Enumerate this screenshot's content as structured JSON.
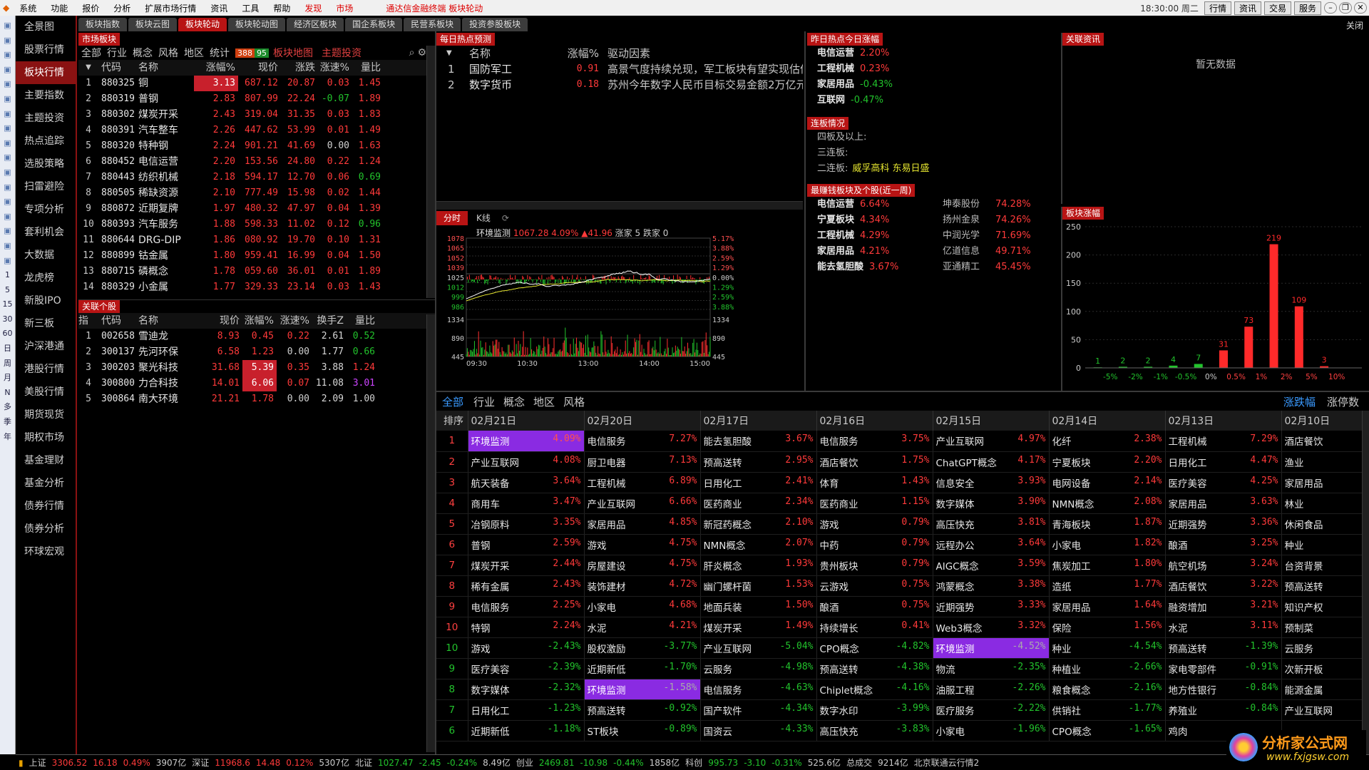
{
  "menubar": {
    "items": [
      "系统",
      "功能",
      "报价",
      "分析",
      "扩展市场行情",
      "资讯",
      "工具",
      "发现",
      "市场"
    ],
    "promo": "通达信金融终端  板块轮动",
    "clock": "18:30:00 周二",
    "right_buttons": [
      "行情",
      "资讯",
      "交易",
      "服务"
    ]
  },
  "iconstrip": [
    "",
    "",
    "",
    "",
    "",
    "",
    "",
    "",
    "",
    "",
    "",
    "",
    "",
    "",
    "",
    "",
    "",
    "1",
    "5",
    "15",
    "30",
    "60",
    "日",
    "周",
    "月",
    "N",
    "多",
    "季",
    "年"
  ],
  "leftnav": [
    "全景图",
    "股票行情",
    "板块行情",
    "主要指数",
    "主题投资",
    "热点追踪",
    "选股策略",
    "扫雷避险",
    "专项分析",
    "套利机会",
    "大数据",
    "龙虎榜",
    "新股IPO",
    "新三板",
    "沪深港通",
    "港股行情",
    "美股行情",
    "期货现货",
    "期权市场",
    "基金理财",
    "基金分析",
    "债券行情",
    "债券分析",
    "环球宏观"
  ],
  "tabs": [
    "板块指数",
    "板块云图",
    "板块轮动",
    "板块轮动图",
    "经济区板块",
    "国企系板块",
    "民营系板块",
    "投资参股板块"
  ],
  "tabs_close": "关闭",
  "market": {
    "title": "市场板块",
    "filters": [
      "全部",
      "行业",
      "概念",
      "风格",
      "地区",
      "统计"
    ],
    "badge_up": "388",
    "badge_dn": "95",
    "links": [
      "板块地图",
      "主题投资"
    ],
    "headers": [
      "",
      "代码",
      "名称",
      "涨幅%",
      "现价",
      "涨跌",
      "涨速%",
      "量比"
    ],
    "rows": [
      [
        "1",
        "880325",
        "铜",
        "3.13",
        "687.12",
        "20.87",
        "0.03",
        "1.45"
      ],
      [
        "2",
        "880319",
        "普钢",
        "2.83",
        "807.99",
        "22.24",
        "-0.07",
        "1.89"
      ],
      [
        "3",
        "880302",
        "煤炭开采",
        "2.43",
        "319.04",
        "31.35",
        "0.03",
        "1.83"
      ],
      [
        "4",
        "880391",
        "汽车整车",
        "2.26",
        "447.62",
        "53.99",
        "0.01",
        "1.49"
      ],
      [
        "5",
        "880320",
        "特种钢",
        "2.24",
        "901.21",
        "41.69",
        "0.00",
        "1.63"
      ],
      [
        "6",
        "880452",
        "电信运营",
        "2.20",
        "153.56",
        "24.80",
        "0.22",
        "1.24"
      ],
      [
        "7",
        "880443",
        "纺织机械",
        "2.18",
        "594.17",
        "12.70",
        "0.06",
        "0.69"
      ],
      [
        "8",
        "880505",
        "稀缺资源",
        "2.10",
        "777.49",
        "15.98",
        "0.02",
        "1.44"
      ],
      [
        "9",
        "880872",
        "近期复牌",
        "1.97",
        "480.32",
        "47.97",
        "0.04",
        "1.39"
      ],
      [
        "10",
        "880393",
        "汽车服务",
        "1.88",
        "598.33",
        "11.02",
        "0.12",
        "0.96"
      ],
      [
        "11",
        "880644",
        "DRG-DIP",
        "1.86",
        "080.92",
        "19.70",
        "0.10",
        "1.31"
      ],
      [
        "12",
        "880899",
        "钴金属",
        "1.80",
        "959.41",
        "16.99",
        "0.04",
        "1.50"
      ],
      [
        "13",
        "880715",
        "磷概念",
        "1.78",
        "059.60",
        "36.01",
        "0.01",
        "1.89"
      ],
      [
        "14",
        "880329",
        "小金属",
        "1.77",
        "329.33",
        "23.14",
        "0.03",
        "1.43"
      ]
    ]
  },
  "related": {
    "title": "关联个股",
    "headers": [
      "指",
      "代码",
      "名称",
      "现价",
      "涨幅%",
      "涨速%",
      "换手Z",
      "量比"
    ],
    "rows": [
      [
        "1",
        "002658",
        "雪迪龙",
        "8.93",
        "0.45",
        "0.22",
        "2.61",
        "0.52"
      ],
      [
        "2",
        "300137",
        "先河环保",
        "6.58",
        "1.23",
        "0.00",
        "1.77",
        "0.66"
      ],
      [
        "3",
        "300203",
        "聚光科技",
        "31.68",
        "5.39",
        "0.35",
        "3.88",
        "1.24"
      ],
      [
        "4",
        "300800",
        "力合科技",
        "14.01",
        "6.06",
        "0.07",
        "11.08",
        "3.01"
      ],
      [
        "5",
        "300864",
        "南大环境",
        "21.21",
        "1.78",
        "0.00",
        "2.09",
        "1.00"
      ]
    ]
  },
  "hotspot": {
    "title": "每日热点预测",
    "headers": [
      "名称",
      "涨幅%",
      "驱动因素"
    ],
    "rows": [
      [
        "1",
        "国防军工",
        "0.91",
        "高景气度持续兑现，军工板块有望实现估值"
      ],
      [
        "2",
        "数字货币",
        "0.18",
        "苏州今年数字人民币目标交易金额2万亿元"
      ]
    ]
  },
  "yesterday": {
    "title": "昨日热点今日涨幅",
    "rows": [
      [
        "电信运营",
        "2.20%"
      ],
      [
        "工程机械",
        "0.23%"
      ],
      [
        "家居用品",
        "-0.43%"
      ],
      [
        "互联网",
        "-0.47%"
      ]
    ]
  },
  "lianban": {
    "title": "连板情况",
    "rows": [
      [
        "四板及以上:",
        ""
      ],
      [
        "三连板:",
        ""
      ],
      [
        "二连板:",
        "威孚高科  东易日盛"
      ]
    ]
  },
  "weekly": {
    "title": "最赚钱板块及个股(近一周)",
    "sectors": [
      [
        "电信运营",
        "6.64%"
      ],
      [
        "宁夏板块",
        "4.34%"
      ],
      [
        "工程机械",
        "4.29%"
      ],
      [
        "家居用品",
        "4.21%"
      ],
      [
        "能去氢胆酸",
        "3.67%"
      ]
    ],
    "stocks": [
      [
        "坤泰股份",
        "74.28%"
      ],
      [
        "扬州金泉",
        "74.26%"
      ],
      [
        "中润光学",
        "71.69%"
      ],
      [
        "亿道信息",
        "49.71%"
      ],
      [
        "亚通精工",
        "45.45%"
      ]
    ]
  },
  "news": {
    "title": "关联资讯",
    "empty": "暂无数据"
  },
  "chart_tabs": [
    "分时",
    "K线"
  ],
  "intraday": {
    "title": "环境监测",
    "price": "1067.28",
    "pct": "4.09%",
    "chg": "▲41.96",
    "up_label": "涨家 5",
    "dn_label": "跌家 0",
    "left_ticks": [
      "1078",
      "1065",
      "1052",
      "1039",
      "1025",
      "1012",
      "999",
      "986",
      "1334",
      "890",
      "445"
    ],
    "right_ticks": [
      "5.17%",
      "3.88%",
      "2.59%",
      "1.29%",
      "0.00%",
      "1.29%",
      "2.59%",
      "3.88%",
      "1334",
      "890",
      "445"
    ],
    "time_ticks": [
      "09:30",
      "10:30",
      "13:00",
      "14:00",
      "15:00"
    ]
  },
  "dist": {
    "title": "板块涨幅",
    "y_ticks": [
      "250",
      "200",
      "150",
      "100",
      "50",
      "0"
    ],
    "x_ticks": [
      "-5%",
      "-2%",
      "-1%",
      "-0.5%",
      "0%",
      "0.5%",
      "1%",
      "2%",
      "5%",
      "10%"
    ]
  },
  "chart_data": {
    "type": "bar",
    "title": "板块涨幅",
    "categories": [
      "<-5%",
      "-5%~-2%",
      "-2%~-1%",
      "-1%~-0.5%",
      "-0.5%~0%",
      "0%~0.5%",
      "0.5%~1%",
      "1%~2%",
      "2%~5%",
      "5%~10%",
      ">10%"
    ],
    "values": [
      1,
      2,
      2,
      4,
      7,
      31,
      73,
      219,
      109,
      3,
      0
    ],
    "ylim": [
      0,
      250
    ],
    "colors": {
      "down": "#22c32c",
      "up": "#ff2a2a"
    }
  },
  "rank": {
    "filters": [
      "全部",
      "行业",
      "概念",
      "地区",
      "风格"
    ],
    "right_tabs": [
      "涨跌幅",
      "涨停数"
    ],
    "headers": [
      "排序",
      "02月21日",
      "02月20日",
      "02月17日",
      "02月16日",
      "02月15日",
      "02月14日",
      "02月13日",
      "02月10日"
    ],
    "rows": [
      [
        "1",
        [
          "环境监测",
          "4.09%"
        ],
        [
          "电信服务",
          "7.27%"
        ],
        [
          "能去氢胆酸",
          "3.67%"
        ],
        [
          "电信服务",
          "3.75%"
        ],
        [
          "产业互联网",
          "4.97%"
        ],
        [
          "化纤",
          "2.38%"
        ],
        [
          "工程机械",
          "7.29%"
        ],
        [
          "酒店餐饮",
          ""
        ]
      ],
      [
        "2",
        [
          "产业互联网",
          "4.08%"
        ],
        [
          "厨卫电器",
          "7.13%"
        ],
        [
          "预高送转",
          "2.95%"
        ],
        [
          "酒店餐饮",
          "1.75%"
        ],
        [
          "ChatGPT概念",
          "4.17%"
        ],
        [
          "宁夏板块",
          "2.20%"
        ],
        [
          "日用化工",
          "4.47%"
        ],
        [
          "渔业",
          ""
        ]
      ],
      [
        "3",
        [
          "航天装备",
          "3.64%"
        ],
        [
          "工程机械",
          "6.89%"
        ],
        [
          "日用化工",
          "2.41%"
        ],
        [
          "体育",
          "1.43%"
        ],
        [
          "信息安全",
          "3.93%"
        ],
        [
          "电网设备",
          "2.14%"
        ],
        [
          "医疗美容",
          "4.25%"
        ],
        [
          "家居用品",
          ""
        ]
      ],
      [
        "4",
        [
          "商用车",
          "3.47%"
        ],
        [
          "产业互联网",
          "6.66%"
        ],
        [
          "医药商业",
          "2.34%"
        ],
        [
          "医药商业",
          "1.15%"
        ],
        [
          "数字媒体",
          "3.90%"
        ],
        [
          "NMN概念",
          "2.08%"
        ],
        [
          "家居用品",
          "3.63%"
        ],
        [
          "林业",
          ""
        ]
      ],
      [
        "5",
        [
          "冶钢原料",
          "3.35%"
        ],
        [
          "家居用品",
          "4.85%"
        ],
        [
          "新冠药概念",
          "2.10%"
        ],
        [
          "游戏",
          "0.79%"
        ],
        [
          "高压快充",
          "3.81%"
        ],
        [
          "青海板块",
          "1.87%"
        ],
        [
          "近期强势",
          "3.36%"
        ],
        [
          "休闲食品",
          ""
        ]
      ],
      [
        "6",
        [
          "普钢",
          "2.59%"
        ],
        [
          "游戏",
          "4.75%"
        ],
        [
          "NMN概念",
          "2.07%"
        ],
        [
          "中药",
          "0.79%"
        ],
        [
          "远程办公",
          "3.64%"
        ],
        [
          "小家电",
          "1.82%"
        ],
        [
          "酿酒",
          "3.25%"
        ],
        [
          "种业",
          ""
        ]
      ],
      [
        "7",
        [
          "煤炭开采",
          "2.44%"
        ],
        [
          "房屋建设",
          "4.75%"
        ],
        [
          "肝炎概念",
          "1.93%"
        ],
        [
          "贵州板块",
          "0.79%"
        ],
        [
          "AIGC概念",
          "3.59%"
        ],
        [
          "焦炭加工",
          "1.80%"
        ],
        [
          "航空机场",
          "3.24%"
        ],
        [
          "台资背景",
          ""
        ]
      ],
      [
        "8",
        [
          "稀有金属",
          "2.43%"
        ],
        [
          "装饰建材",
          "4.72%"
        ],
        [
          "幽门螺杆菌",
          "1.53%"
        ],
        [
          "云游戏",
          "0.75%"
        ],
        [
          "鸿蒙概念",
          "3.38%"
        ],
        [
          "造纸",
          "1.77%"
        ],
        [
          "酒店餐饮",
          "3.22%"
        ],
        [
          "预高送转",
          ""
        ]
      ],
      [
        "9",
        [
          "电信服务",
          "2.25%"
        ],
        [
          "小家电",
          "4.68%"
        ],
        [
          "地面兵装",
          "1.50%"
        ],
        [
          "酿酒",
          "0.75%"
        ],
        [
          "近期强势",
          "3.33%"
        ],
        [
          "家居用品",
          "1.64%"
        ],
        [
          "融资增加",
          "3.21%"
        ],
        [
          "知识产权",
          ""
        ]
      ],
      [
        "10",
        [
          "特钢",
          "2.24%"
        ],
        [
          "水泥",
          "4.21%"
        ],
        [
          "煤炭开采",
          "1.49%"
        ],
        [
          "持续增长",
          "0.41%"
        ],
        [
          "Web3概念",
          "3.32%"
        ],
        [
          "保险",
          "1.56%"
        ],
        [
          "水泥",
          "3.11%"
        ],
        [
          "预制菜",
          ""
        ]
      ],
      [
        "10",
        [
          "游戏",
          "-2.43%"
        ],
        [
          "股权激励",
          "-3.77%"
        ],
        [
          "产业互联网",
          "-5.04%"
        ],
        [
          "CPO概念",
          "-4.82%"
        ],
        [
          "环境监测",
          "-4.52%"
        ],
        [
          "种业",
          "-4.54%"
        ],
        [
          "预高送转",
          "-1.39%"
        ],
        [
          "云服务",
          ""
        ]
      ],
      [
        "9",
        [
          "医疗美容",
          "-2.39%"
        ],
        [
          "近期新低",
          "-1.70%"
        ],
        [
          "云服务",
          "-4.98%"
        ],
        [
          "预高送转",
          "-4.38%"
        ],
        [
          "物流",
          "-2.35%"
        ],
        [
          "种植业",
          "-2.66%"
        ],
        [
          "家电零部件",
          "-0.91%"
        ],
        [
          "次新开板",
          ""
        ]
      ],
      [
        "8",
        [
          "数字媒体",
          "-2.32%"
        ],
        [
          "环境监测",
          "-1.58%"
        ],
        [
          "电信服务",
          "-4.63%"
        ],
        [
          "Chiplet概念",
          "-4.16%"
        ],
        [
          "油服工程",
          "-2.26%"
        ],
        [
          "粮食概念",
          "-2.16%"
        ],
        [
          "地方性银行",
          "-0.84%"
        ],
        [
          "能源金属",
          ""
        ]
      ],
      [
        "7",
        [
          "日用化工",
          "-1.23%"
        ],
        [
          "预高送转",
          "-0.92%"
        ],
        [
          "国产软件",
          "-4.34%"
        ],
        [
          "数字水印",
          "-3.99%"
        ],
        [
          "医疗服务",
          "-2.22%"
        ],
        [
          "供销社",
          "-1.77%"
        ],
        [
          "养殖业",
          "-0.84%"
        ],
        [
          "产业互联网",
          ""
        ]
      ],
      [
        "6",
        [
          "近期新低",
          "-1.18%"
        ],
        [
          "ST板块",
          "-0.89%"
        ],
        [
          "国资云",
          "-4.33%"
        ],
        [
          "高压快充",
          "-3.83%"
        ],
        [
          "小家电",
          "-1.96%"
        ],
        [
          "CPO概念",
          "-1.65%"
        ],
        [
          "鸡肉",
          ""
        ],
        [
          "",
          ""
        ]
      ]
    ]
  },
  "status": {
    "items": [
      [
        "上证",
        "3306.52",
        "16.18",
        "0.49%",
        "3907亿"
      ],
      [
        "深证",
        "11968.6",
        "14.48",
        "0.12%",
        "5307亿"
      ],
      [
        "北证",
        "1027.47",
        "-2.45",
        "-0.24%",
        "8.49亿"
      ],
      [
        "创业",
        "2469.81",
        "-10.98",
        "-0.44%",
        "1858亿"
      ],
      [
        "科创",
        "995.73",
        "-3.10",
        "-0.31%",
        "525.6亿"
      ]
    ],
    "total_label": "总成交",
    "total": "9214亿",
    "server": "北京联通云行情2"
  },
  "watermark": {
    "cn": "分析家公式网",
    "url": "www.fxjgsw.com"
  }
}
